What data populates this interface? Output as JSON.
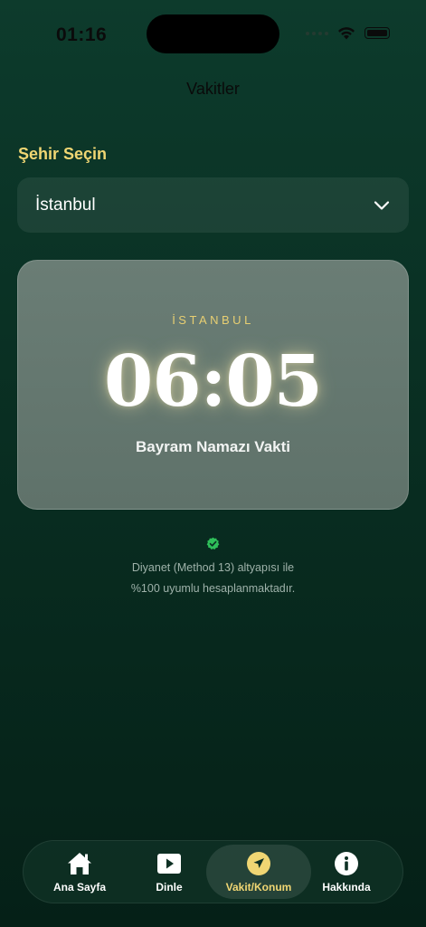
{
  "status_bar": {
    "time": "01:16"
  },
  "nav": {
    "title": "Vakitler"
  },
  "city_picker": {
    "label": "Şehir Seçin",
    "selected": "İstanbul"
  },
  "prayer_card": {
    "city": "İSTANBUL",
    "time": "06:05",
    "label": "Bayram Namazı Vakti"
  },
  "verification": {
    "line1": "Diyanet (Method 13) altyapısı ile",
    "line2": "%100 uyumlu hesaplanmaktadır."
  },
  "tab_bar": {
    "tabs": [
      {
        "label": "Ana Sayfa",
        "icon": "home-icon"
      },
      {
        "label": "Dinle",
        "icon": "play-icon"
      },
      {
        "label": "Vakit/Konum",
        "icon": "location-arrow-icon"
      },
      {
        "label": "Hakkında",
        "icon": "info-icon"
      }
    ],
    "active_index": 2
  },
  "colors": {
    "accent_gold": "#f0d673",
    "background": "#0a3124",
    "verify_green": "#2fbf5a"
  }
}
